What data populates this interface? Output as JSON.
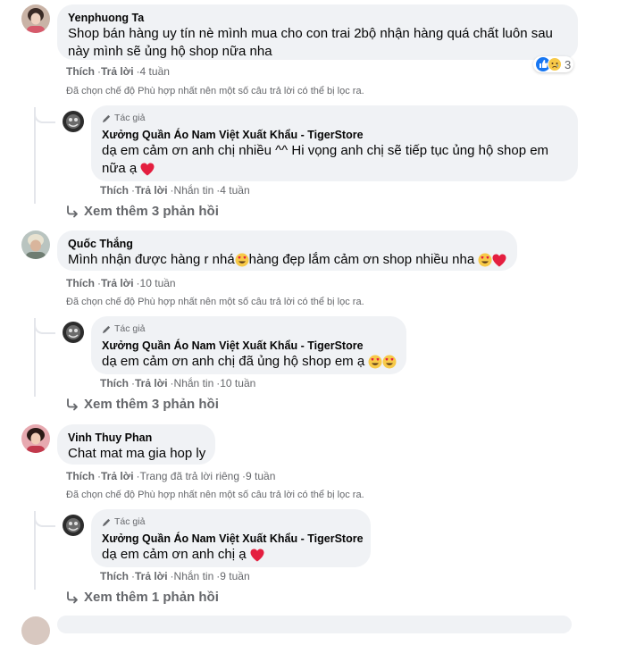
{
  "labels": {
    "like": "Thích",
    "reply": "Trả lời",
    "message": "Nhắn tin",
    "author_badge": "Tác giả"
  },
  "filter_note": "Đã chọn chế độ Phù hợp nhất nên một số câu trả lời có thể bị lọc ra.",
  "comments": [
    {
      "author": "Yenphuong Ta",
      "text_line1": "Shop bán hàng uy tín nè mình mua cho con trai 2bộ nhận hàng quá chất luôn sau",
      "text_line2": "này mình sẽ ủng hộ shop nữa nha",
      "time": "4 tuần",
      "reaction_count": "3",
      "reply": {
        "author": "Xưởng Quần Áo Nam Việt Xuất Khẩu - TigerStore",
        "text_line1": "dạ em cảm ơn anh chị nhiều ^^ Hi vọng anh chị sẽ tiếp tục ủng hộ shop em",
        "text_line2": "nữa ạ",
        "time": "4 tuần"
      },
      "more_replies": "Xem thêm 3 phản hồi"
    },
    {
      "author": "Quốc Thắng",
      "text_a": "Mình nhận được hàng r nhá",
      "text_b": "hàng đẹp lắm cảm ơn shop nhiều nha",
      "time": "10 tuần",
      "reply": {
        "author": "Xưởng Quần Áo Nam Việt Xuất Khẩu - TigerStore",
        "text_line1": "dạ em cảm ơn anh chị đã ủng hộ shop em ạ",
        "time": "10 tuần"
      },
      "more_replies": "Xem thêm 3 phản hồi"
    },
    {
      "author": "Vinh Thuy Phan",
      "text_line1": "Chat mat ma gia hop ly",
      "page_replied": "Trang đã trả lời riêng",
      "time": "9 tuần",
      "reply": {
        "author": "Xưởng Quần Áo Nam Việt Xuất Khẩu - TigerStore",
        "text_line1": "dạ em cảm ơn anh chị ạ",
        "time": "9 tuần"
      },
      "more_replies": "Xem thêm 1 phản hồi"
    }
  ],
  "colors": {
    "bubble": "#f0f2f5",
    "meta": "#65676b",
    "thread_line": "#e4e6eb",
    "heart": "#e41e3f",
    "like_blue": "#1877f2"
  }
}
